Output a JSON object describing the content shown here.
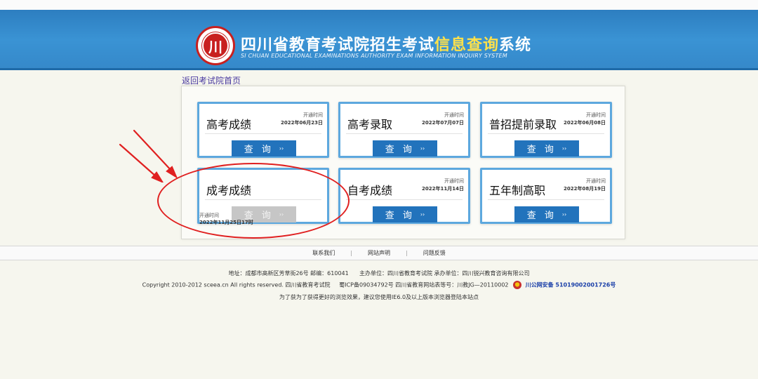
{
  "header": {
    "title_part1": "四川省教育考试院招生考试",
    "title_highlight": "信息查询",
    "title_part2": "系统",
    "subtitle": "SI CHUAN EDUCATIONAL EXAMINATIONS AUTHORITY EXAM INFORMATION INQUIRY SYSTEM",
    "logo_icon": "seal-logo",
    "logo_glyph": "川",
    "brand_color": "#2d7ec0",
    "highlight_color": "#ffe14a"
  },
  "nav": {
    "back_label": "返回考试院首页"
  },
  "cards": [
    {
      "name": "高考成绩",
      "open_label": "开通时间",
      "open_date": "2022年06月23日",
      "button": "查 询",
      "enabled": true
    },
    {
      "name": "高考录取",
      "open_label": "开通时间",
      "open_date": "2022年07月07日",
      "button": "查 询",
      "enabled": true
    },
    {
      "name": "普招提前录取",
      "open_label": "开通时间",
      "open_date": "2022年06月08日",
      "button": "查 询",
      "enabled": true
    },
    {
      "name": "成考成绩",
      "open_label": "开通时间",
      "open_date": "2022年11月25日17时",
      "button": "查 询",
      "enabled": false
    },
    {
      "name": "自考成绩",
      "open_label": "开通时间",
      "open_date": "2022年11月14日",
      "button": "查 询",
      "enabled": true
    },
    {
      "name": "五年制高职",
      "open_label": "开通时间",
      "open_date": "2022年08月19日",
      "button": "查 询",
      "enabled": true
    }
  ],
  "button_arrow": "››",
  "footer": {
    "links": [
      "联系我们",
      "网站声明",
      "问题反馈"
    ],
    "address": "地址：成都市高新区芳草街26号 邮编：610041",
    "host": "主办单位：四川省教育考试院 承办单位：四川锐兴教育咨询有限公司",
    "copyright": "Copyright 2010-2012 sceea.cn All rights reserved. 四川省教育考试院",
    "icp": "蜀ICP备09034792号 四川省教育网站表等号：川教JG—20110002",
    "police_icon": "police-badge-icon",
    "police_record": "川公网安备 51019002001726号",
    "browser_tip": "为了获为了获得更好的浏览效果，建议您使用IE6.0及以上版本浏览器登陆本站点"
  },
  "annotation_color": "#e02020"
}
